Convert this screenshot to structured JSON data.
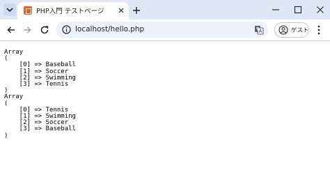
{
  "browser": {
    "tab_title": "PHP入門 テストページ",
    "url": "localhost/hello.php",
    "profile_label": "ゲスト"
  },
  "page": {
    "output": "Array\n(\n    [0] => Baseball\n    [1] => Soccer\n    [2] => Swimming\n    [3] => Tennis\n)\nArray\n(\n    [0] => Tennis\n    [1] => Swimming\n    [2] => Soccer\n    [3] => Baseball\n)"
  },
  "colors": {
    "titlebar": "#dfe7f5",
    "omnibox": "#edf2fa",
    "favicon": "#e65f2b"
  },
  "icons": [
    "tab-list-icon",
    "php-favicon-icon",
    "close-icon",
    "plus-icon",
    "minimize-icon",
    "maximize-icon",
    "window-close-icon",
    "back-arrow-icon",
    "forward-arrow-icon",
    "reload-icon",
    "site-info-icon",
    "translate-icon",
    "profile-icon",
    "more-menu-icon"
  ]
}
